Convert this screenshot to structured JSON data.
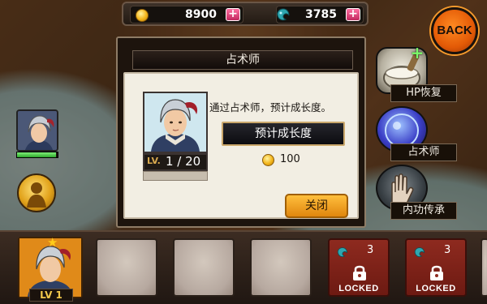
{
  "currency": {
    "gold": "8900",
    "gems": "3785",
    "plus_label": "+"
  },
  "nav": {
    "back_label": "BACK"
  },
  "skills": {
    "hp_restore": "HP恢复",
    "fortune": "占术师",
    "inner_power": "内功传承"
  },
  "dialog": {
    "title": "占术师",
    "description": "通过占术师，预计成长度。",
    "forecast_button": "预计成长度",
    "cost": "100",
    "close_button": "关闭",
    "hero": {
      "level_tag": "LV.",
      "level": "1 / 20",
      "stars": 1
    }
  },
  "party": {
    "leader_level": "LV 1",
    "slots": [
      {
        "state": "hero"
      },
      {
        "state": "empty"
      },
      {
        "state": "empty"
      },
      {
        "state": "empty"
      },
      {
        "state": "locked",
        "cost": "3",
        "label": "LOCKED"
      },
      {
        "state": "locked",
        "cost": "3",
        "label": "LOCKED"
      }
    ]
  },
  "hero_panel": {
    "hp_fraction": 0.95
  },
  "colors": {
    "accent_orange": "#e35a06",
    "gold": "#f3b51a",
    "gem_teal": "#2ea7b0",
    "locked_red": "#8e2a1f",
    "hp_green": "#2ea62c"
  }
}
